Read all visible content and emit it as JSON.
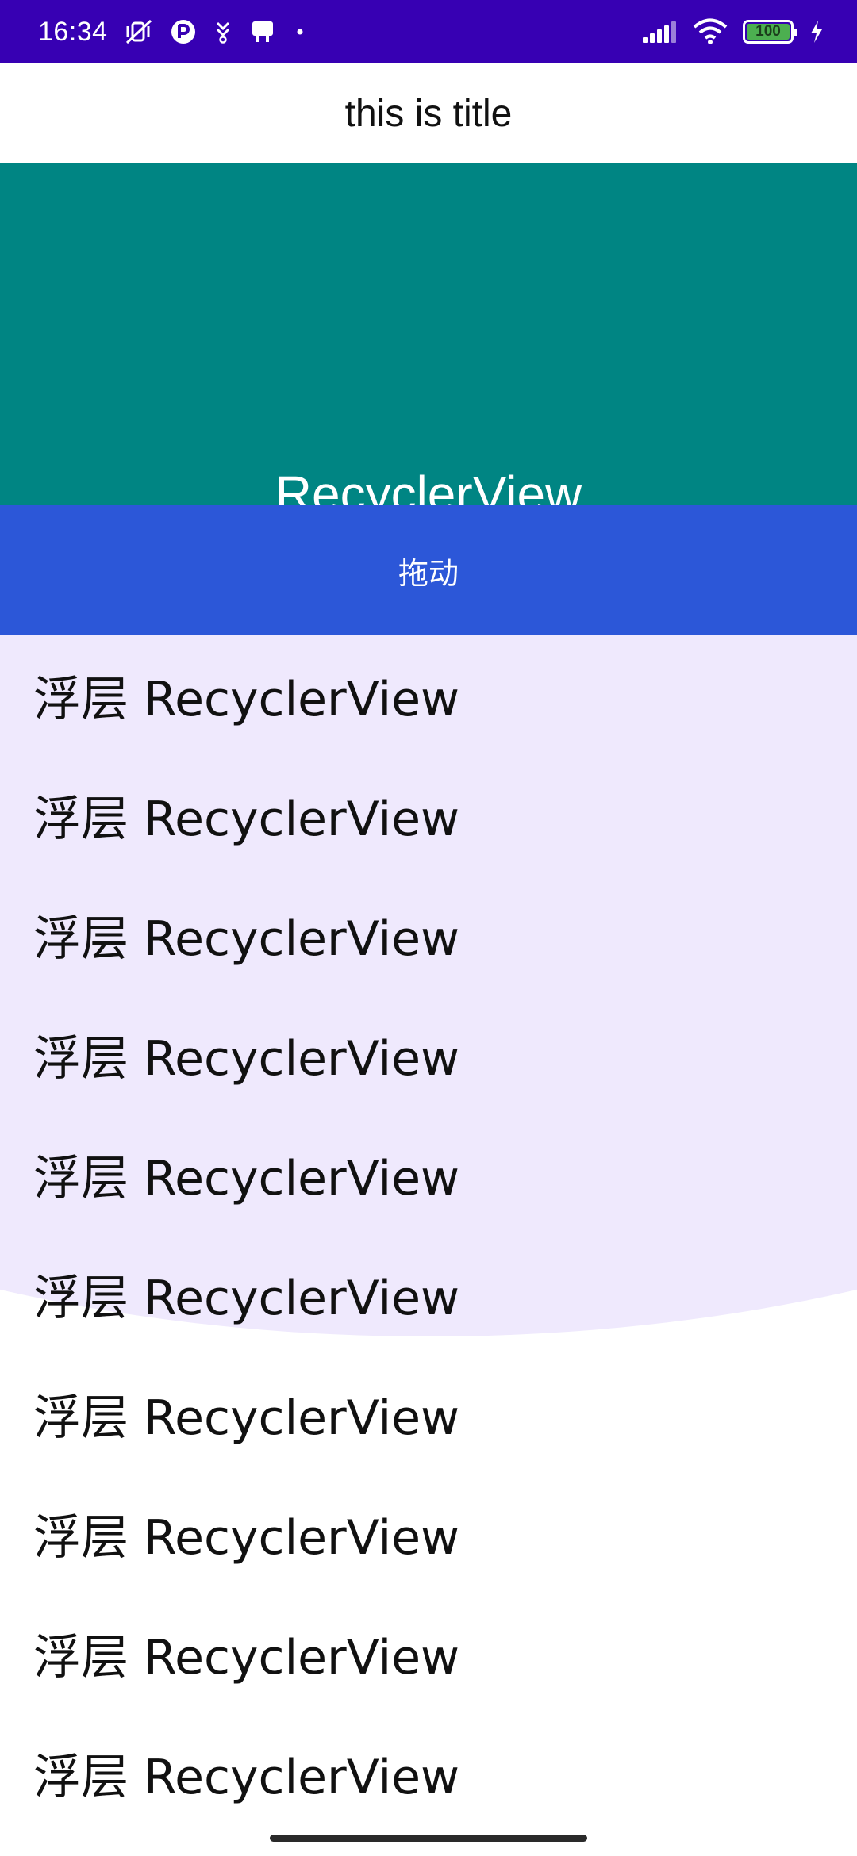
{
  "status_bar": {
    "time": "16:34",
    "battery_level": "100",
    "background_color": "#3700b3",
    "icons": [
      "mute-vibrate-icon",
      "app-badge-icon",
      "download-icon",
      "notification-icon",
      "dot-icon",
      "signal-icon",
      "wifi-icon",
      "battery-icon",
      "charging-icon"
    ]
  },
  "header": {
    "title": "this is title"
  },
  "background_view": {
    "label": "RecyclerView",
    "color": "#008583"
  },
  "drag_bar": {
    "label": "拖动",
    "color": "#2c57d8"
  },
  "overlay_list": {
    "accent_color": "#efe9fd",
    "items": [
      {
        "label": "浮层 RecyclerView"
      },
      {
        "label": "浮层 RecyclerView"
      },
      {
        "label": "浮层 RecyclerView"
      },
      {
        "label": "浮层 RecyclerView"
      },
      {
        "label": "浮层 RecyclerView"
      },
      {
        "label": "浮层 RecyclerView"
      },
      {
        "label": "浮层 RecyclerView"
      },
      {
        "label": "浮层 RecyclerView"
      },
      {
        "label": "浮层 RecyclerView"
      },
      {
        "label": "浮层 RecyclerView"
      }
    ]
  }
}
